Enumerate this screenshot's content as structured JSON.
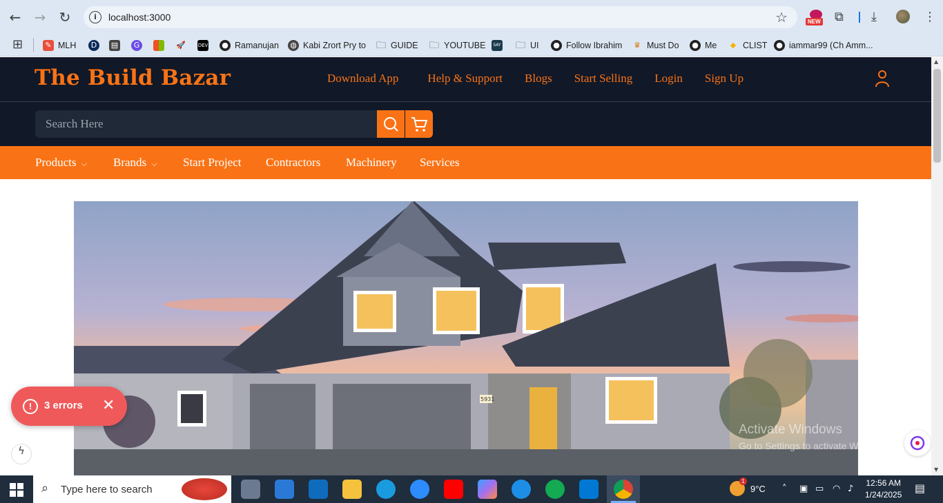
{
  "browser": {
    "url": "localhost:3000",
    "bookmarks": [
      {
        "label": "",
        "icon": "apps-grid-icon"
      },
      {
        "label": "MLH",
        "icon": "mlh-icon"
      },
      {
        "label": "",
        "icon": "d-icon"
      },
      {
        "label": "",
        "icon": "page-icon"
      },
      {
        "label": "",
        "icon": "notification-icon"
      },
      {
        "label": "",
        "icon": "microsoft-icon"
      },
      {
        "label": "",
        "icon": "rocket-icon"
      },
      {
        "label": "",
        "icon": "dev-icon"
      },
      {
        "label": "Ramanujan",
        "icon": "github-icon"
      },
      {
        "label": "Kabi Zrort Pry to",
        "icon": "globe-icon"
      },
      {
        "label": "GUIDE",
        "icon": "folder-icon"
      },
      {
        "label": "YOUTUBE",
        "icon": "folder-icon"
      },
      {
        "label": "",
        "icon": "say-text-icon"
      },
      {
        "label": "UI",
        "icon": "folder-icon"
      },
      {
        "label": "Follow Ibrahim",
        "icon": "github-icon"
      },
      {
        "label": "Must Do",
        "icon": "must-do-icon"
      },
      {
        "label": "Me",
        "icon": "github-icon"
      },
      {
        "label": "CLIST",
        "icon": "clist-icon"
      },
      {
        "label": "iammar99 (Ch Amm...",
        "icon": "github-icon"
      }
    ],
    "new_badge": "NEW"
  },
  "site": {
    "brand": "The Build Bazar",
    "top_links": [
      "Download App",
      "Help & Support",
      "Blogs",
      "Start Selling",
      "Login",
      "Sign Up"
    ],
    "search_placeholder": "Search Here",
    "nav": {
      "products": "Products",
      "brands": "Brands",
      "start_project": "Start Project",
      "contractors": "Contractors",
      "machinery": "Machinery",
      "services": "Services"
    },
    "hero_image_alt": "house at dusk",
    "house_number": "5931"
  },
  "overlay": {
    "errors_label": "3 errors",
    "watermark_line1": "Activate Windows",
    "watermark_line2": "Go to Settings to activate Windows."
  },
  "taskbar": {
    "search_placeholder": "Type here to search",
    "weather": "9°C",
    "time": "12:56 AM",
    "date": "1/24/2025",
    "weather_badge": "1"
  },
  "colors": {
    "brand_orange": "#f97316",
    "header_dark": "#111827",
    "error_red": "#f0595a"
  }
}
